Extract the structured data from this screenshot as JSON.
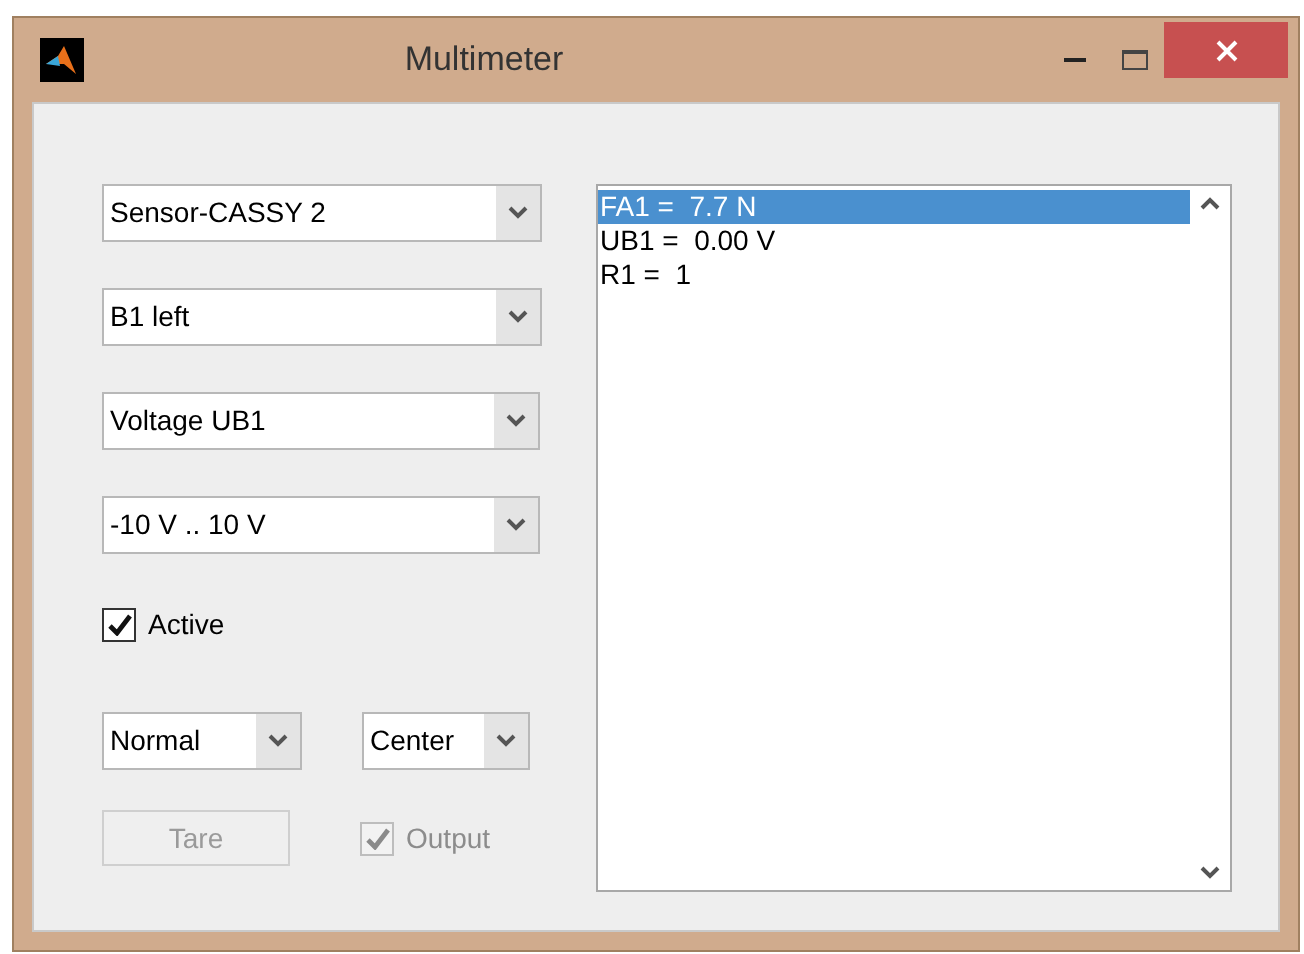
{
  "window": {
    "title": "Multimeter"
  },
  "selectors": [
    {
      "value": "Sensor-CASSY 2"
    },
    {
      "value": "B1 left"
    },
    {
      "value": "Voltage UB1"
    },
    {
      "value": "-10 V .. 10 V"
    }
  ],
  "active": {
    "label": "Active",
    "checked": true,
    "disabled": false
  },
  "modes": [
    {
      "value": "Normal"
    },
    {
      "value": "Center"
    }
  ],
  "tare": {
    "label": "Tare",
    "disabled": true
  },
  "output": {
    "label": "Output",
    "checked": true,
    "disabled": true
  },
  "readings": [
    {
      "text": "FA1 =  7.7 N",
      "selected": true
    },
    {
      "text": "UB1 =  0.00 V",
      "selected": false
    },
    {
      "text": "R1 =  1",
      "selected": false
    }
  ]
}
